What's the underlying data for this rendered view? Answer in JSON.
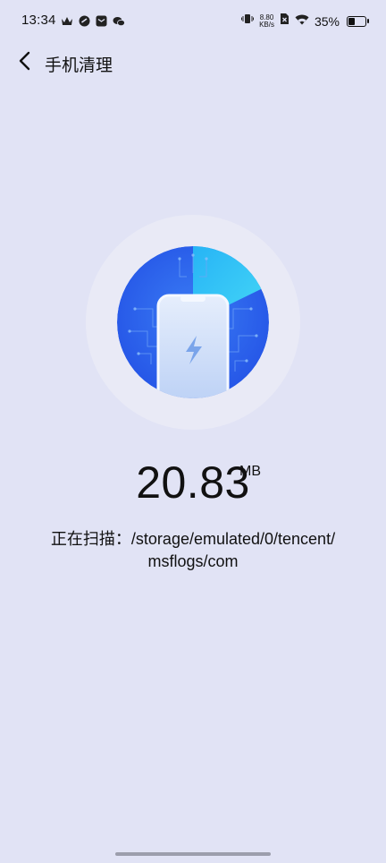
{
  "status_bar": {
    "time": "13:34",
    "net_speed_value": "8.80",
    "net_speed_unit": "KB/s",
    "battery_percent": "35%",
    "battery_level": 0.35,
    "left_icons": [
      "crown-icon",
      "link-icon",
      "mail-icon",
      "wechat-icon"
    ],
    "right_icons": [
      "vibrate-icon",
      "no-sim-icon",
      "wifi-icon",
      "battery-icon"
    ]
  },
  "header": {
    "back_icon": "chevron-left-icon",
    "title": "手机清理"
  },
  "scan": {
    "graphic_icon": "phone-bolt-icon",
    "size_value": "20.83",
    "size_unit": "MB",
    "path_text": "正在扫描：/storage/emulated/0/tencent/",
    "path_text_line2": "msflogs/com"
  },
  "colors": {
    "background": "#e1e3f5",
    "disc_primary": "#2e63ee",
    "disc_accent": "#2ec6f4"
  }
}
